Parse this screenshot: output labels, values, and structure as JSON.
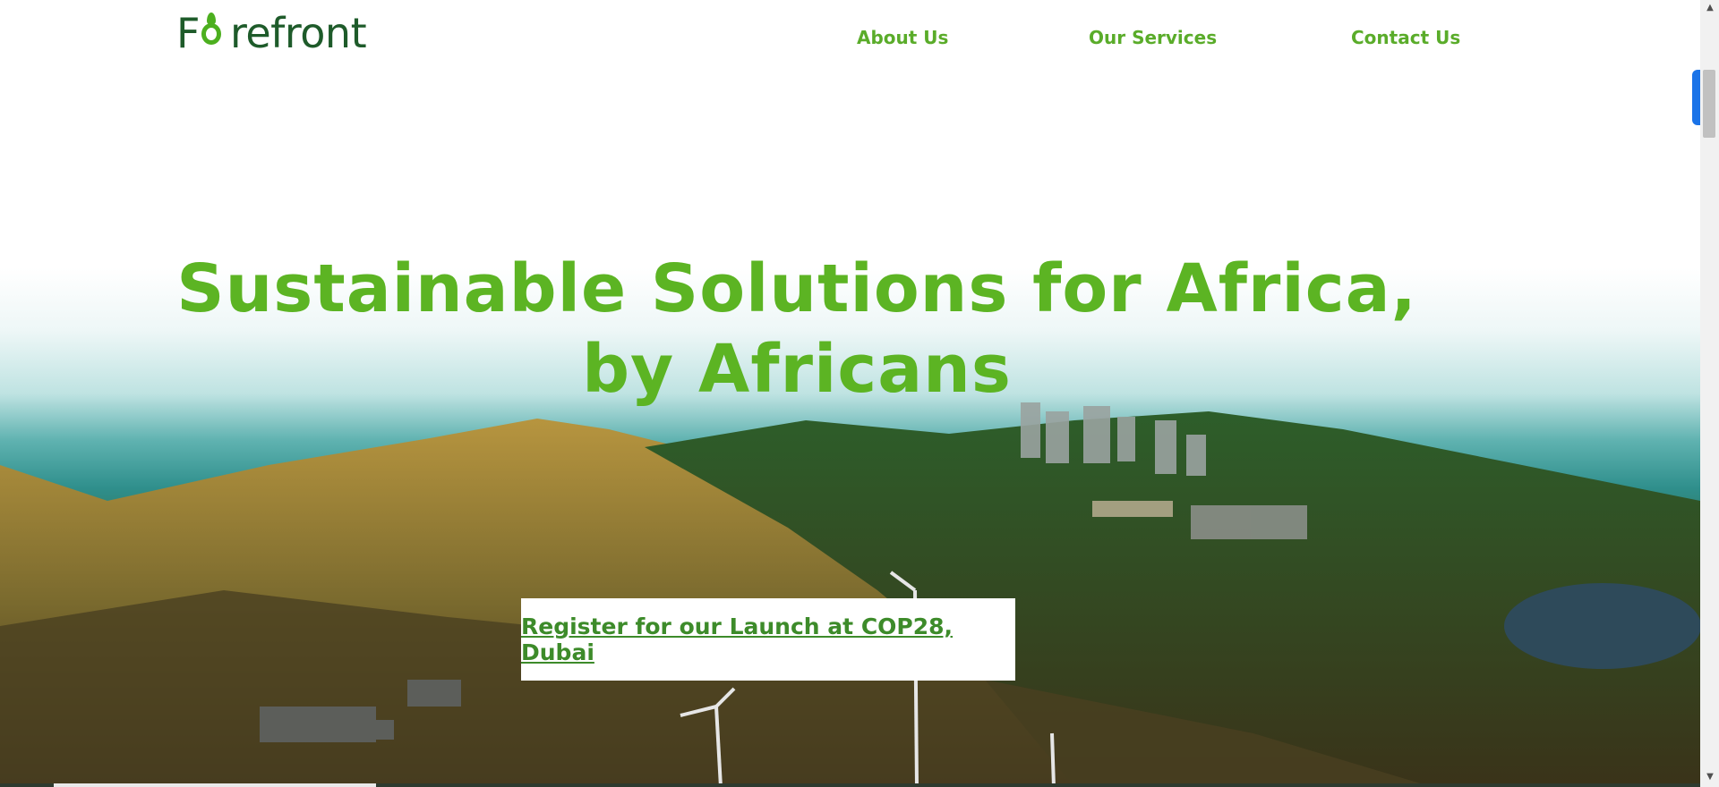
{
  "brand": {
    "logo_text_start": "F",
    "logo_text_end": "refront"
  },
  "nav": {
    "items": [
      {
        "label": "About Us"
      },
      {
        "label": "Our Services"
      },
      {
        "label": "Contact Us"
      }
    ]
  },
  "hero": {
    "headline_line1": "Sustainable Solutions for Africa,",
    "headline_line2": "by Africans",
    "cta_label": "Register for our Launch at COP28, Dubai"
  },
  "colors": {
    "brand_dark": "#1e5b2a",
    "brand_green": "#5cb423",
    "nav_green": "#5aac2a",
    "cta_green": "#3d8b2a"
  }
}
